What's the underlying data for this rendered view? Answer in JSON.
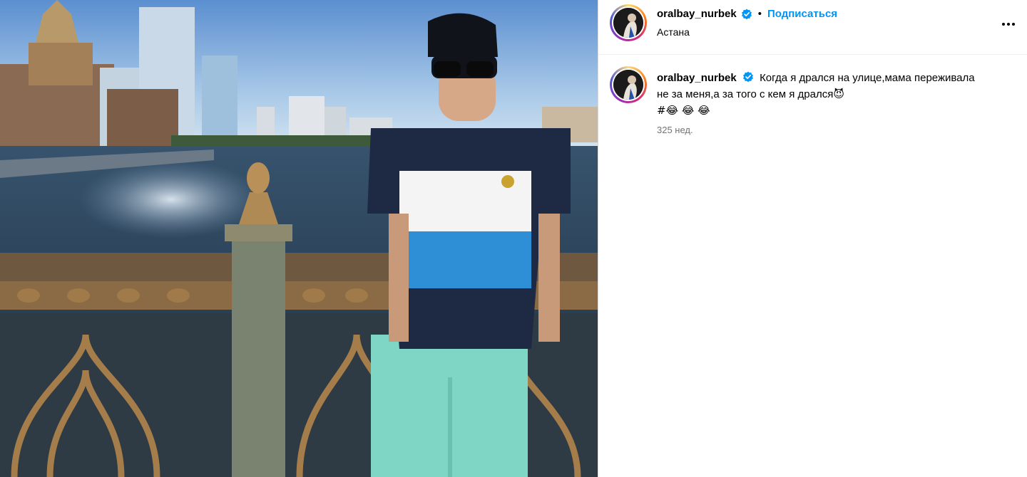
{
  "post": {
    "author": {
      "username": "oralbay_nurbek",
      "verified": true,
      "location": "Астана"
    },
    "follow_label": "Подписаться",
    "separator": "•",
    "caption": {
      "line1": "Когда я дрался на улице,мама переживала",
      "line2": "не за меня,а за того с кем я дрался",
      "line2_emoji": "😈",
      "line3": "#😂 😂 😂"
    },
    "timestamp": "325 нед.",
    "icons": {
      "verified": "verified-badge-icon",
      "more": "more-options-icon"
    },
    "colors": {
      "accent": "#0095f6",
      "secondary_text": "#737373",
      "border": "#dbdbdb"
    }
  }
}
